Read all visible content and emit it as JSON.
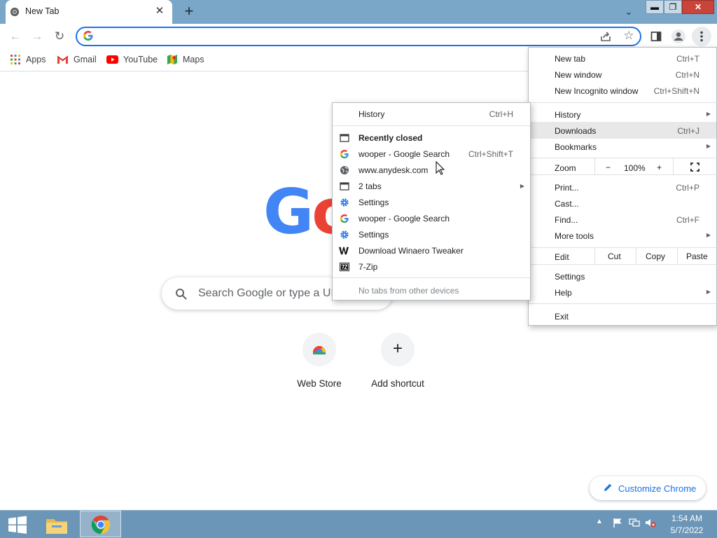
{
  "tab": {
    "title": "New Tab",
    "close_glyph": "✕"
  },
  "window": {
    "new_tab_glyph": "+",
    "tab_search_glyph": "⌄",
    "min_glyph": "▬",
    "max_glyph": "❐",
    "close_glyph": "✕"
  },
  "toolbar": {
    "back_glyph": "←",
    "forward_glyph": "→",
    "reload_glyph": "↻",
    "omnibox_value": "",
    "star_glyph": "☆"
  },
  "bookmarks": [
    {
      "label": "Apps",
      "icon": "apps-grid-icon"
    },
    {
      "label": "Gmail",
      "icon": "gmail-icon"
    },
    {
      "label": "YouTube",
      "icon": "youtube-icon"
    },
    {
      "label": "Maps",
      "icon": "maps-icon"
    }
  ],
  "content": {
    "logo_letters": [
      "G",
      "o"
    ],
    "search_placeholder": "Search Google or type a URL",
    "shortcuts": [
      {
        "label": "Web Store"
      },
      {
        "label": "Add shortcut",
        "glyph": "+"
      }
    ],
    "customize_label": "Customize Chrome"
  },
  "main_menu": {
    "items": [
      {
        "label": "New tab",
        "shortcut": "Ctrl+T"
      },
      {
        "label": "New window",
        "shortcut": "Ctrl+N"
      },
      {
        "label": "New Incognito window",
        "shortcut": "Ctrl+Shift+N"
      },
      {
        "label": "History",
        "submenu": true
      },
      {
        "label": "Downloads",
        "shortcut": "Ctrl+J"
      },
      {
        "label": "Bookmarks",
        "submenu": true
      },
      {
        "label": "Zoom"
      },
      {
        "label": "Print...",
        "shortcut": "Ctrl+P"
      },
      {
        "label": "Cast..."
      },
      {
        "label": "Find...",
        "shortcut": "Ctrl+F"
      },
      {
        "label": "More tools",
        "submenu": true
      },
      {
        "label": "Edit"
      },
      {
        "label": "Settings"
      },
      {
        "label": "Help",
        "submenu": true
      },
      {
        "label": "Exit"
      }
    ],
    "zoom": {
      "minus": "−",
      "value": "100%",
      "plus": "+"
    },
    "edit": {
      "cut": "Cut",
      "copy": "Copy",
      "paste": "Paste"
    },
    "highlighted": "Downloads"
  },
  "history_menu": {
    "history_label": "History",
    "history_shortcut": "Ctrl+H",
    "recently_closed_label": "Recently closed",
    "items": [
      {
        "label": "wooper - Google Search",
        "shortcut": "Ctrl+Shift+T",
        "icon": "google-g-icon"
      },
      {
        "label": "www.anydesk.com",
        "icon": "globe-icon"
      },
      {
        "label": "2 tabs",
        "icon": "window-icon",
        "submenu": true
      },
      {
        "label": "Settings",
        "icon": "settings-gear-icon"
      },
      {
        "label": "wooper - Google Search",
        "icon": "google-g-icon"
      },
      {
        "label": "Settings",
        "icon": "settings-gear-icon"
      },
      {
        "label": "Download Winaero Tweaker",
        "icon": "winaero-w-icon"
      },
      {
        "label": "7-Zip",
        "icon": "7zip-icon"
      }
    ],
    "footer": "No tabs from other devices"
  },
  "taskbar": {
    "time": "1:54 AM",
    "date": "5/7/2022",
    "tray_arrow": "▲"
  },
  "colors": {
    "titlebar": "#7aa6c8",
    "accent": "#1a73e8",
    "taskbar": "#6b96b8",
    "google_blue": "#4285f4",
    "google_red": "#ea4335"
  }
}
